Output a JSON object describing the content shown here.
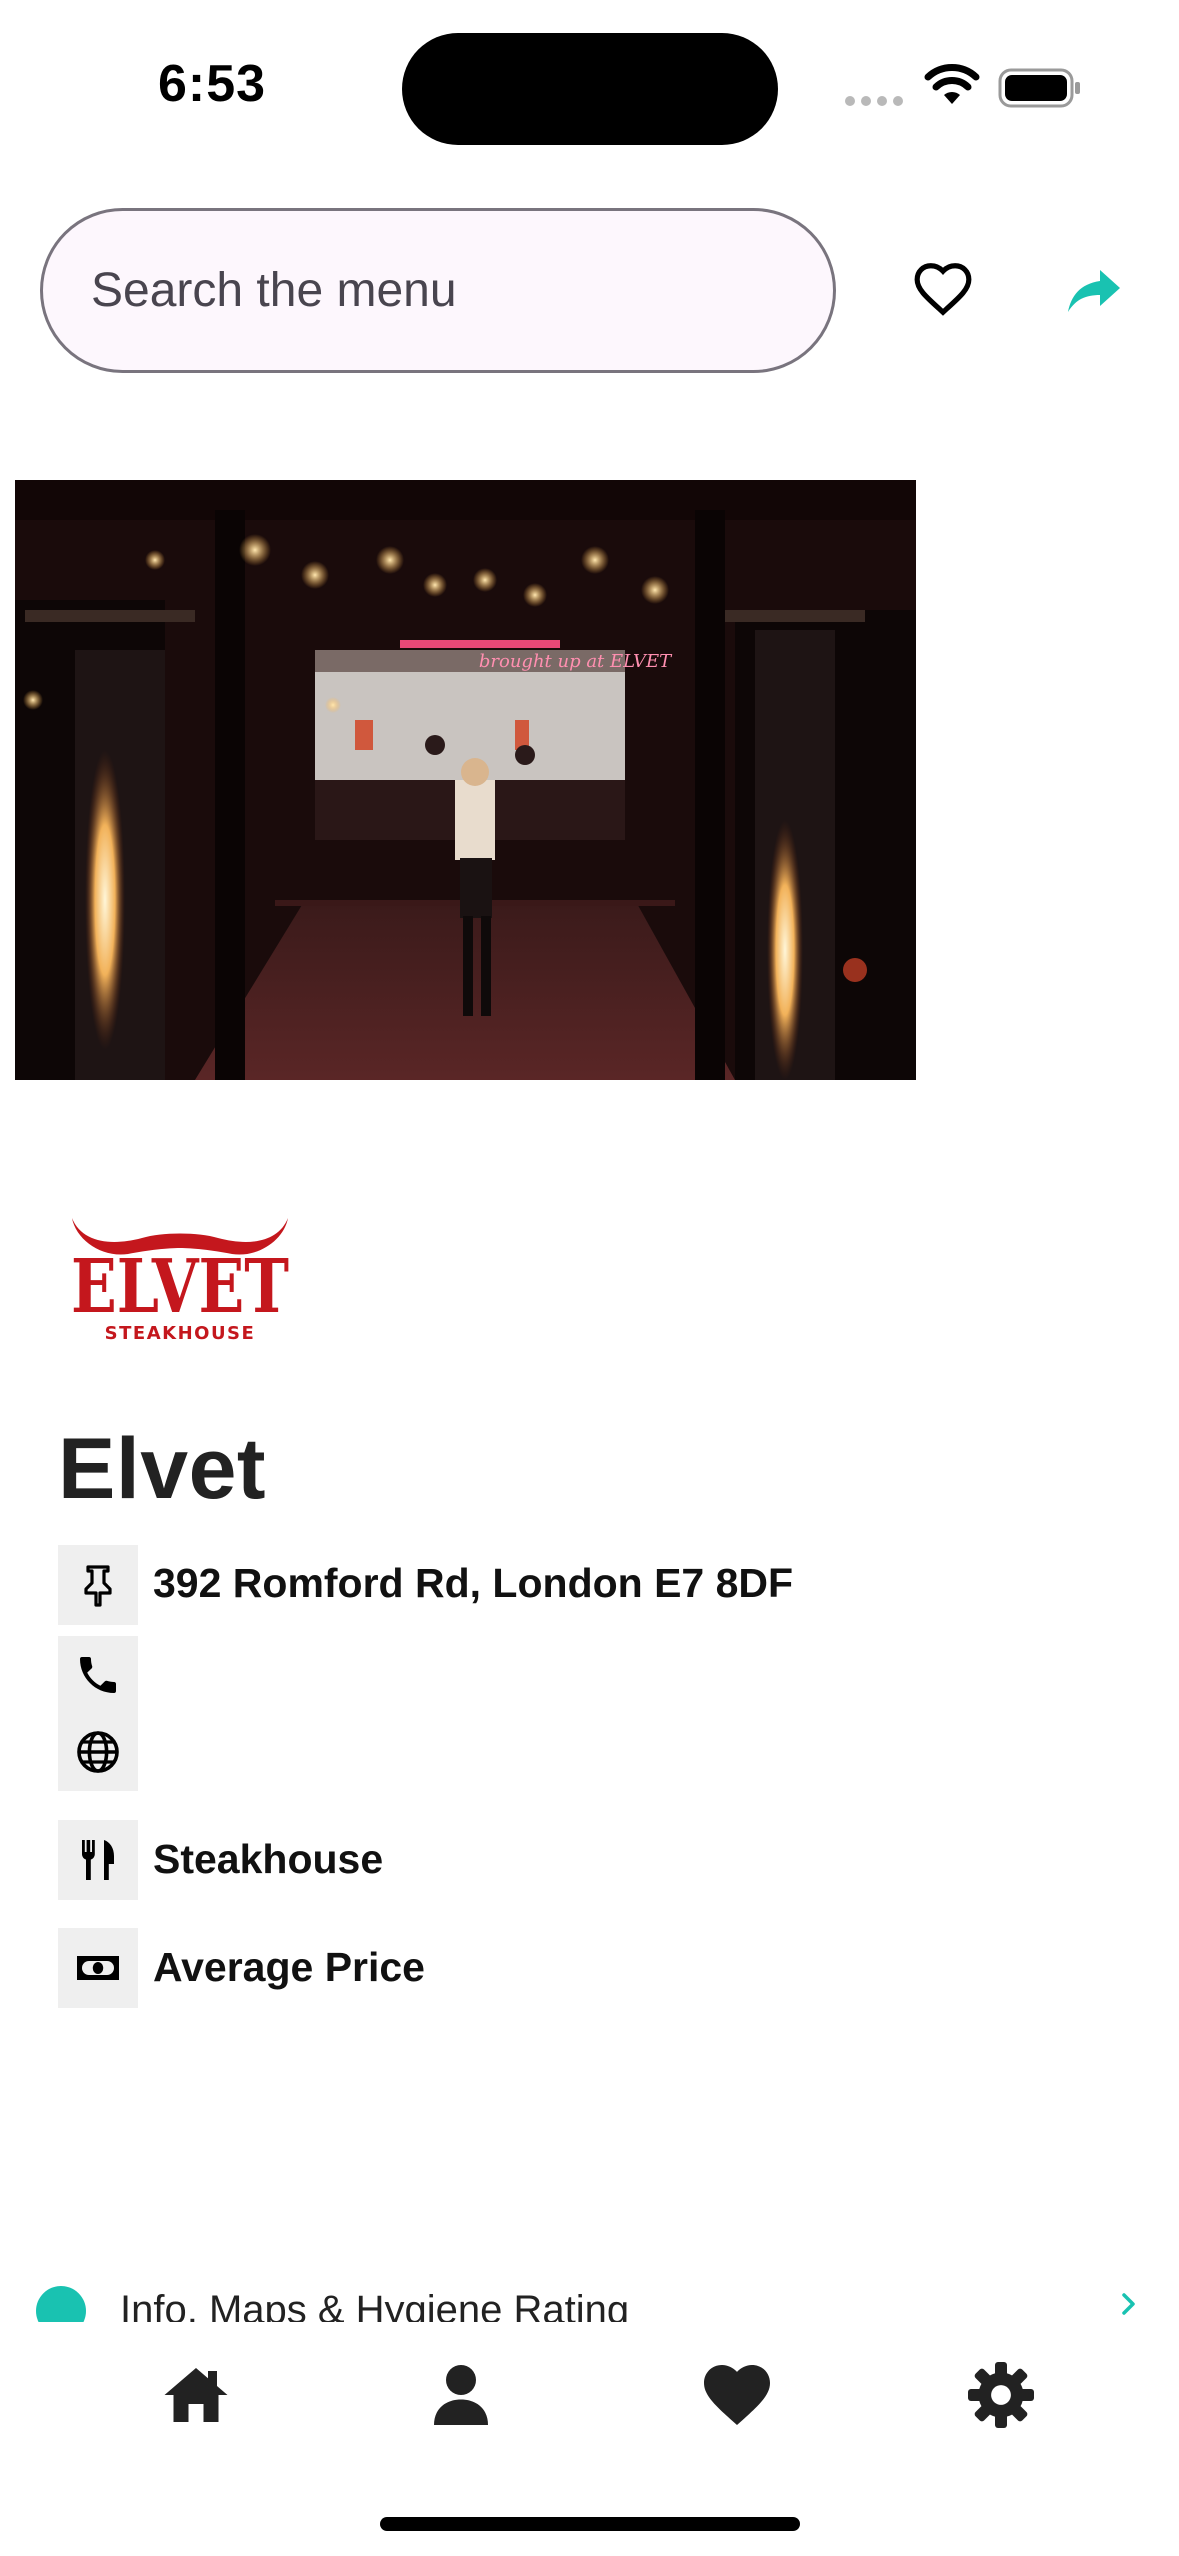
{
  "status_bar": {
    "time": "6:53"
  },
  "search": {
    "placeholder": "Search the menu"
  },
  "restaurant": {
    "name": "Elvet",
    "logo_text": "ELVET",
    "logo_subtext": "STEAKHOUSE",
    "address": "392 Romford Rd, London E7 8DF",
    "cuisine": "Steakhouse",
    "price": "Average Price",
    "hero_sign_text": "brought up at ELVET"
  },
  "info_link": {
    "label": "Info, Maps & Hygiene Rating"
  },
  "tab_bar": {
    "items": [
      {
        "icon": "home-icon"
      },
      {
        "icon": "person-icon"
      },
      {
        "icon": "heart-icon"
      },
      {
        "icon": "gear-icon"
      }
    ]
  },
  "colors": {
    "accent": "#19c2b1",
    "logo_red": "#c4171d",
    "search_bg": "#fdf7fd",
    "search_border": "#79747e",
    "icon_box": "#efefef"
  }
}
